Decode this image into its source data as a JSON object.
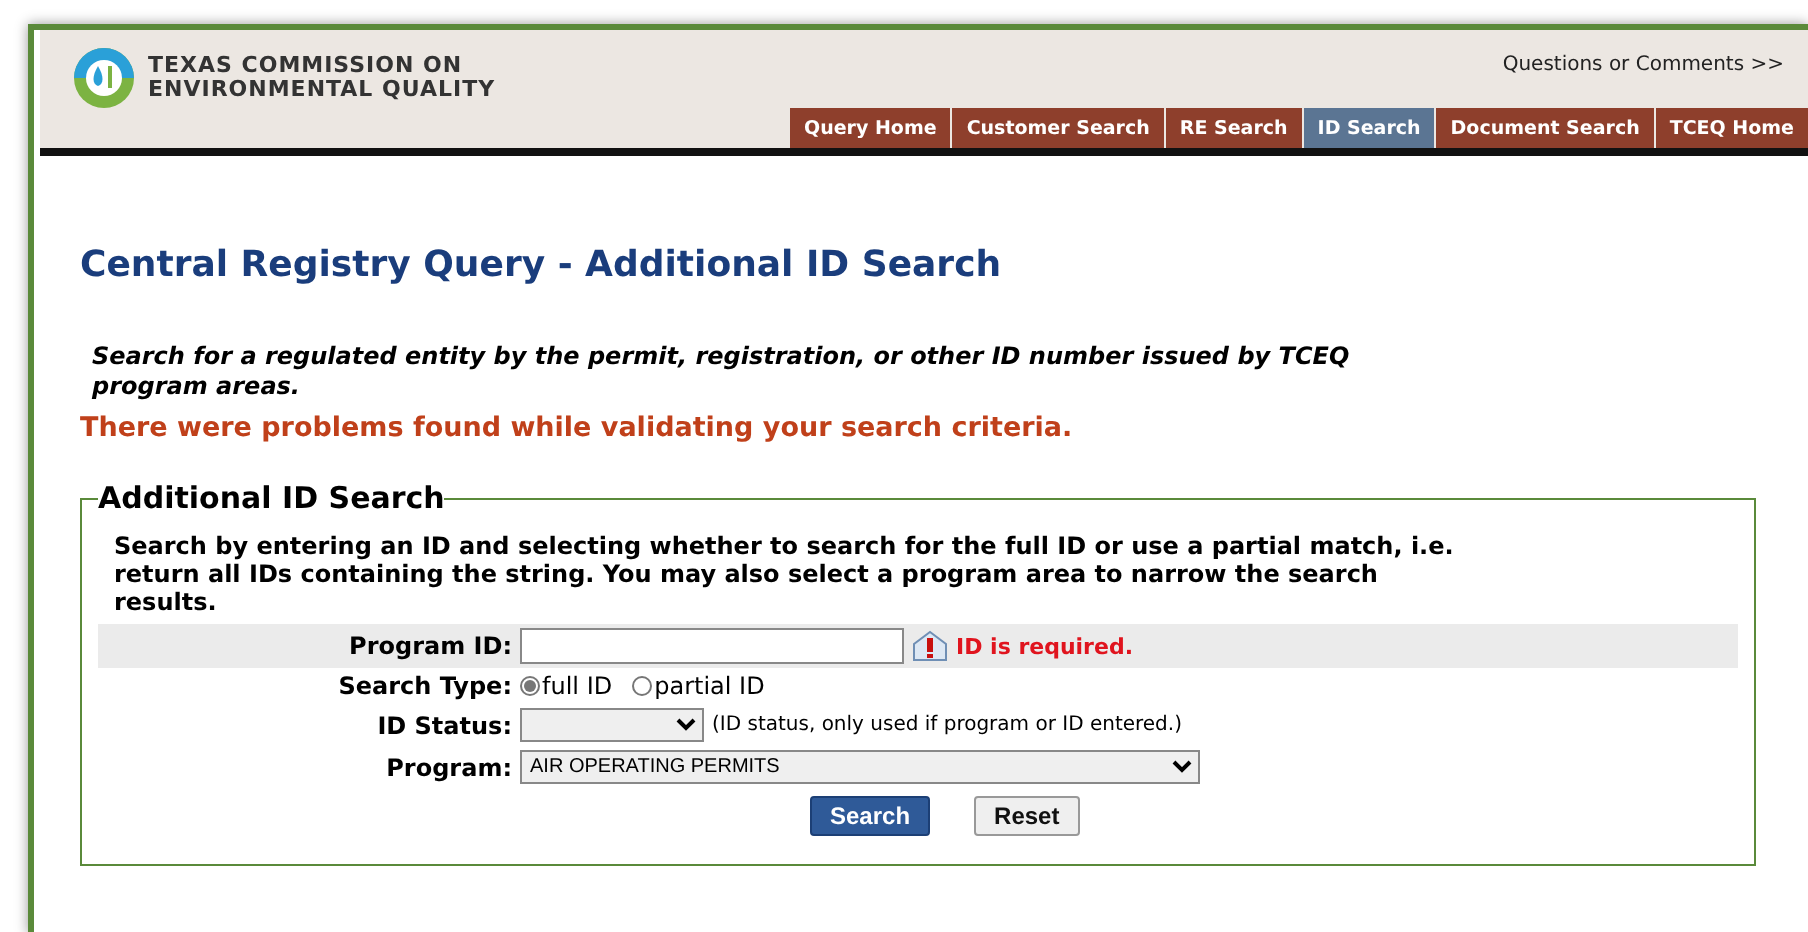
{
  "header": {
    "logo_line_1": "TEXAS COMMISSION ON",
    "logo_line_2": "ENVIRONMENTAL QUALITY",
    "link": "Questions or Comments >>"
  },
  "nav": [
    {
      "label": "Query Home",
      "selected": false
    },
    {
      "label": "Customer Search",
      "selected": false
    },
    {
      "label": "RE Search",
      "selected": false
    },
    {
      "label": "ID Search",
      "selected": true
    },
    {
      "label": "Document Search",
      "selected": false
    },
    {
      "label": "TCEQ Home",
      "selected": false
    }
  ],
  "page_title": "Central Registry Query - Additional ID Search",
  "intro": "Search for a regulated entity by the permit, registration, or other ID number issued by TCEQ program areas.",
  "error": "There were problems found while validating your search criteria.",
  "form": {
    "legend": "Additional ID Search",
    "instructions": "Search by entering an ID and selecting whether to search for the full ID or use a partial match, i.e. return all IDs containing the string. You may also select a program area to narrow the search results.",
    "program_id": {
      "label": "Program ID:",
      "error": "ID is required."
    },
    "search_type": {
      "label": "Search Type:",
      "options": [
        {
          "label": "full ID",
          "selected": true
        },
        {
          "label": "partial ID",
          "selected": false
        }
      ]
    },
    "id_status": {
      "label": "ID Status:",
      "note": "(ID status, only used if program or ID entered.)"
    },
    "program": {
      "label": "Program:",
      "value": "AIR OPERATING PERMITS"
    },
    "buttons": [
      {
        "label": "Search",
        "kind": "primary"
      },
      {
        "label": "Reset",
        "kind": "secondary"
      }
    ]
  }
}
